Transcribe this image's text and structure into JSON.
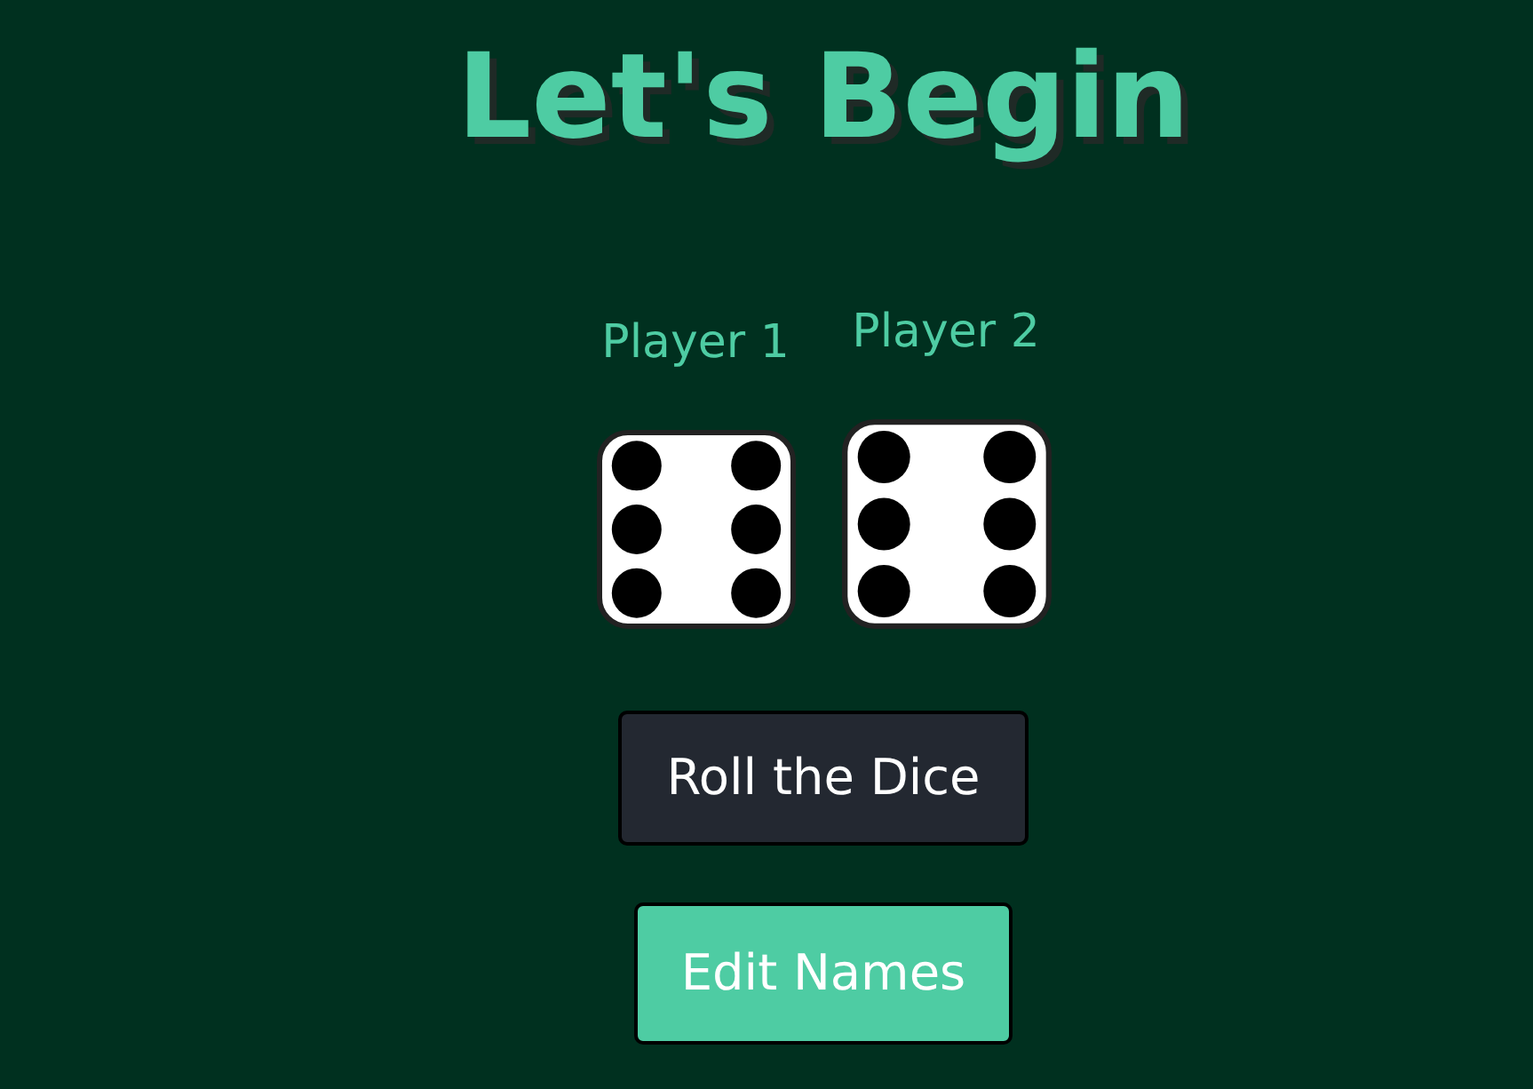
{
  "title": "Let's Begin",
  "players": [
    {
      "name": "Player 1",
      "kind": "six"
    },
    {
      "name": "Player 2",
      "kind": "six"
    }
  ],
  "buttons": [
    {
      "label": "Roll the Dice",
      "kind": "dark"
    },
    {
      "label": "Edit Names",
      "kind": "accent"
    }
  ]
}
